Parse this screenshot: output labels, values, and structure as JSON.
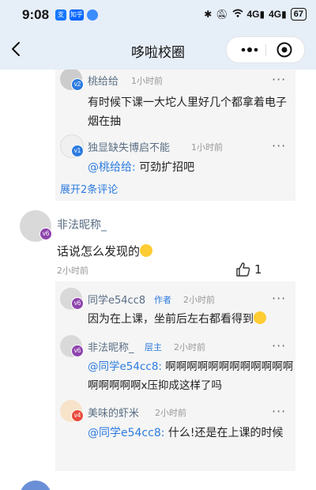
{
  "status": {
    "time": "9:08",
    "app1": "支",
    "app2": "知乎",
    "signal1": "4G",
    "signal2": "4G",
    "battery": "67"
  },
  "nav": {
    "title": "哆啦校圈"
  },
  "thread1": {
    "reply1": {
      "name": "桃给给",
      "level": "v2",
      "time": "1小时前",
      "text": "有时候下课一大坨人里好几个都拿着电子烟在抽"
    },
    "reply2": {
      "name": "独显缺失博启不能",
      "level": "v1",
      "time": "1小时前",
      "mention": "@桃给给:",
      "text": " 可劲扩招吧"
    },
    "expand": "展开2条评论"
  },
  "comment": {
    "name": "非法昵称_",
    "level": "v6",
    "text": "话说怎么发现的",
    "time": "2小时前",
    "likes": "1"
  },
  "replies": [
    {
      "name": "同学e54cc8",
      "tag": "作者",
      "level": "v6",
      "time": "2小时前",
      "mention": "",
      "text": "因为在上课，坐前后左右都看得到"
    },
    {
      "name": "非法昵称_",
      "tag": "层主",
      "level": "v6",
      "time": "2小时前",
      "mention": "@同学e54cc8:",
      "text": " 啊啊啊啊啊啊啊啊啊啊啊啊啊啊啊啊啊x压抑成这样了吗"
    },
    {
      "name": "美味的虾米",
      "tag": "",
      "level": "v4",
      "time": "2小时前",
      "mention": "@同学e54cc8:",
      "text": " 什么!还是在上课的时候"
    }
  ],
  "colors": {
    "accent": "#2c7be0",
    "badge_v6": "#8e44ad",
    "badge_v4": "#e94b3c",
    "badge_v2": "#2c7be0",
    "header_bg": "#e6eef8"
  },
  "icons": [
    "back-arrow-icon",
    "more-dots-icon",
    "mini-close-icon",
    "thumbs-up-icon"
  ]
}
